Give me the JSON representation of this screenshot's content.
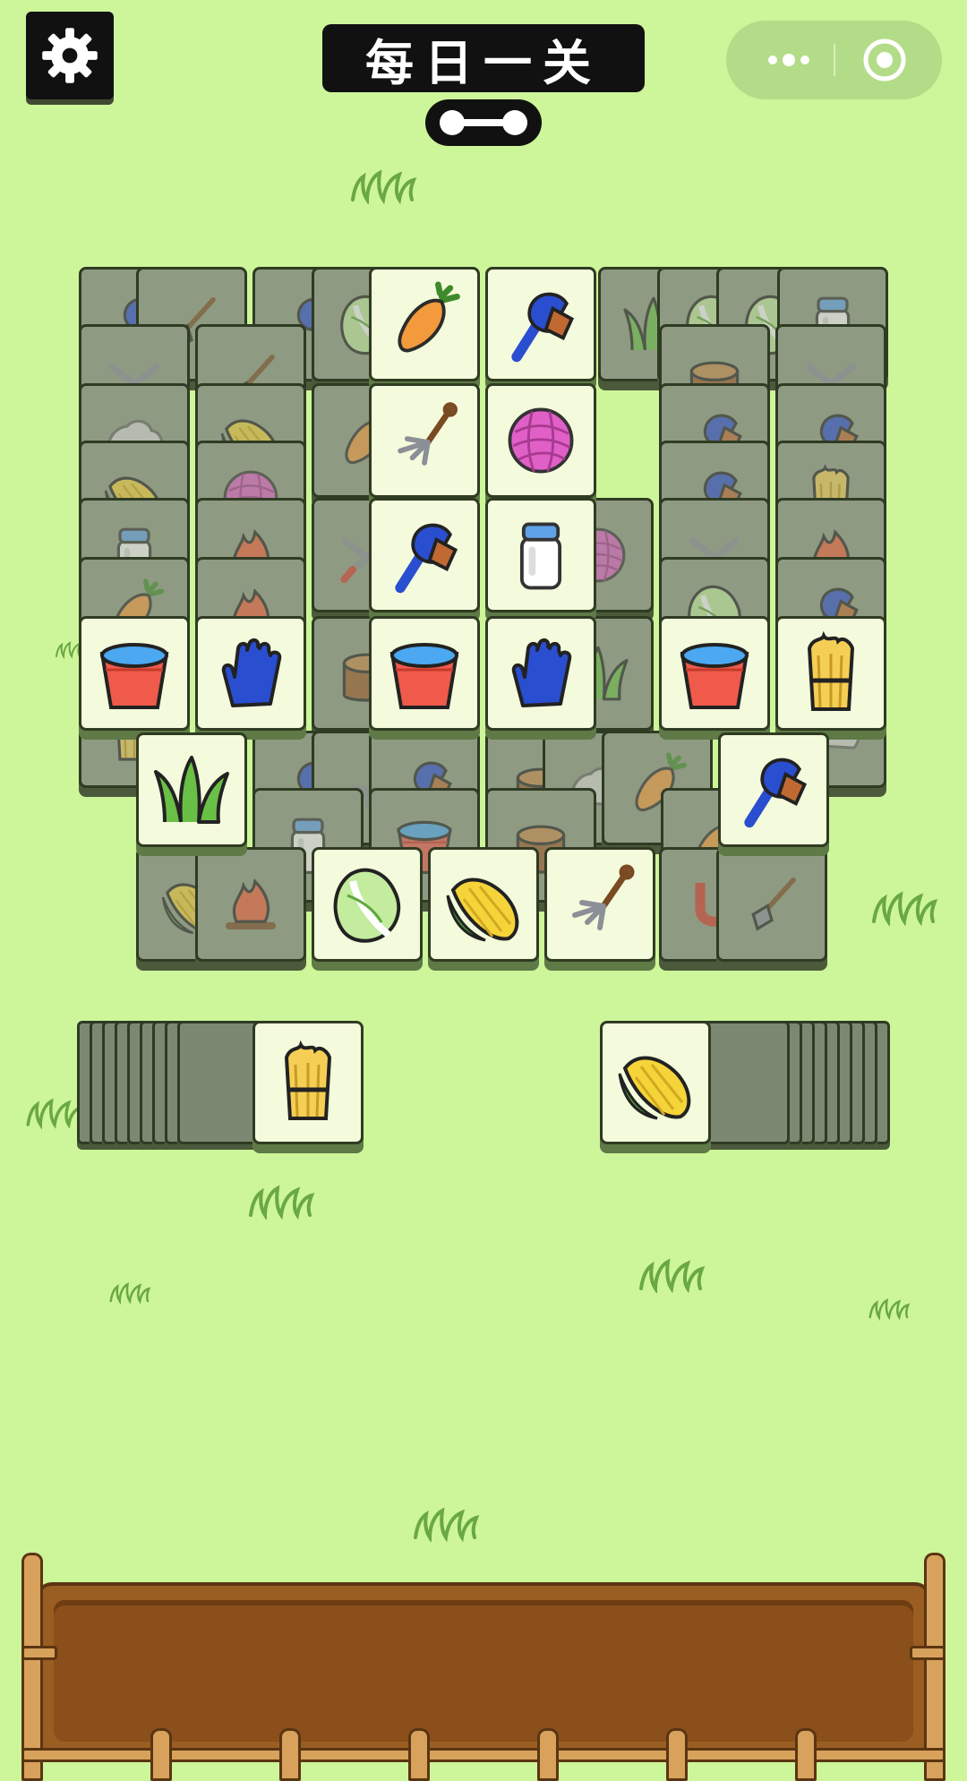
{
  "header": {
    "title": "每日一关",
    "settings_icon": "gear-icon",
    "progress_icon": "progress-pill-icon",
    "menu_icon": "more-dots-icon",
    "close_icon": "target-close-icon"
  },
  "board": {
    "covered_tiles": [
      "shovel",
      "pruning-shears",
      "rock",
      "corn",
      "jar",
      "carrot",
      "brush",
      "cabbage",
      "log-stump",
      "yarn",
      "campfire",
      "grass-tuft",
      "pitchfork",
      "bucket",
      "wheat-bundle",
      "horseshoe-magnet"
    ],
    "active_tiles": [
      {
        "icon": "carrot",
        "row": 1
      },
      {
        "icon": "brush",
        "row": 1
      },
      {
        "icon": "pitchfork",
        "row": 2
      },
      {
        "icon": "yarn",
        "row": 2
      },
      {
        "icon": "brush",
        "row": 3
      },
      {
        "icon": "milk-jar",
        "row": 3
      },
      {
        "icon": "bucket",
        "row": 4
      },
      {
        "icon": "glove",
        "row": 4
      },
      {
        "icon": "bucket",
        "row": 4
      },
      {
        "icon": "glove",
        "row": 4
      },
      {
        "icon": "bucket",
        "row": 4
      },
      {
        "icon": "wheat-bundle",
        "row": 4
      },
      {
        "icon": "grass-tuft",
        "row": 5
      },
      {
        "icon": "brush",
        "row": 5
      },
      {
        "icon": "cabbage",
        "row": 6
      },
      {
        "icon": "corn",
        "row": 6
      },
      {
        "icon": "pitchfork",
        "row": 6
      }
    ]
  },
  "left_stack": {
    "top_icon": "wheat-bundle"
  },
  "right_stack": {
    "top_icon": "corn"
  },
  "tray": {
    "slot_count": 7
  }
}
